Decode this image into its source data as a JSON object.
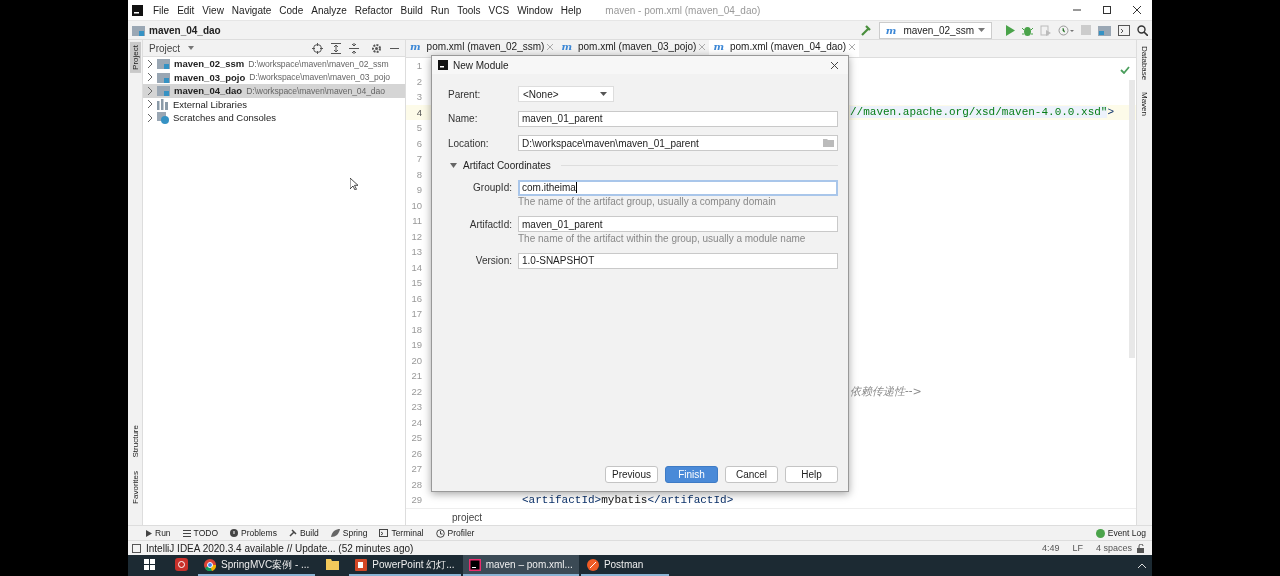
{
  "menu_bar": {
    "items": [
      "File",
      "Edit",
      "View",
      "Navigate",
      "Code",
      "Analyze",
      "Refactor",
      "Build",
      "Run",
      "Tools",
      "VCS",
      "Window",
      "Help"
    ],
    "title": "maven - pom.xml (maven_04_dao)"
  },
  "nav_bar": {
    "breadcrumb": "maven_04_dao",
    "run_config": "maven_02_ssm",
    "run_config_icon": "m"
  },
  "left_strip": [
    {
      "label": "Project",
      "selected": true
    },
    {
      "label": "Structure",
      "selected": false
    },
    {
      "label": "Favorites",
      "selected": false
    }
  ],
  "right_strip": [
    {
      "label": "Database"
    },
    {
      "label": "Maven"
    }
  ],
  "project_panel": {
    "title": "Project",
    "items": [
      {
        "kind": "module",
        "name": "maven_02_ssm",
        "path": "D:\\workspace\\maven\\maven_02_ssm",
        "selected": false
      },
      {
        "kind": "module",
        "name": "maven_03_pojo",
        "path": "D:\\workspace\\maven\\maven_03_pojo",
        "selected": false
      },
      {
        "kind": "module",
        "name": "maven_04_dao",
        "path": "D:\\workspace\\maven\\maven_04_dao",
        "selected": true
      },
      {
        "kind": "library",
        "name": "External Libraries",
        "selected": false
      },
      {
        "kind": "scratches",
        "name": "Scratches and Consoles",
        "selected": false
      }
    ]
  },
  "editor": {
    "tabs": [
      {
        "icon": "m",
        "label": "pom.xml (maven_02_ssm)",
        "selected": false
      },
      {
        "icon": "m",
        "label": "pom.xml (maven_03_pojo)",
        "selected": false
      },
      {
        "icon": "m",
        "label": "pom.xml (maven_04_dao)",
        "selected": true
      }
    ],
    "lines": [
      {
        "number": "1",
        "current": false
      },
      {
        "number": "2",
        "current": false
      },
      {
        "number": "3",
        "current": false
      },
      {
        "number": "4",
        "current": true,
        "kind": "after-dialog",
        "parts": [
          {
            "kind": "string",
            "text": "//maven.apache.org/xsd/maven-4.0.0.xsd\""
          },
          {
            "kind": "tag",
            "text": ">"
          }
        ]
      },
      {
        "number": "5",
        "current": false
      },
      {
        "number": "6",
        "current": false
      },
      {
        "number": "7",
        "current": false
      },
      {
        "number": "8",
        "current": false
      },
      {
        "number": "9",
        "current": false
      },
      {
        "number": "10",
        "current": false
      },
      {
        "number": "11",
        "current": false
      },
      {
        "number": "12",
        "current": false
      },
      {
        "number": "13",
        "current": false
      },
      {
        "number": "14",
        "current": false
      },
      {
        "number": "15",
        "current": false
      },
      {
        "number": "16",
        "current": false
      },
      {
        "number": "17",
        "current": false
      },
      {
        "number": "18",
        "current": false
      },
      {
        "number": "19",
        "current": false
      },
      {
        "number": "20",
        "current": false
      },
      {
        "number": "21",
        "current": false
      },
      {
        "number": "22",
        "current": false,
        "kind": "after-dialog",
        "parts": [
          {
            "kind": "comment",
            "text": "依赖传递性-->"
          }
        ]
      },
      {
        "number": "23",
        "current": false
      },
      {
        "number": "24",
        "current": false
      },
      {
        "number": "25",
        "current": false
      },
      {
        "number": "26",
        "current": false
      },
      {
        "number": "27",
        "current": false
      },
      {
        "number": "28",
        "current": false
      },
      {
        "number": "29",
        "current": false,
        "kind": "code",
        "parts": [
          {
            "kind": "tag",
            "text": "<artifactId>"
          },
          {
            "kind": "text",
            "text": "mybatis"
          },
          {
            "kind": "tag",
            "text": "</artifactId>"
          }
        ]
      }
    ],
    "breadcrumb": "project"
  },
  "dialog": {
    "title": "New Module",
    "fields": [
      {
        "kind": "dropdown",
        "label": "Parent:",
        "value": "<None>",
        "focused": false
      },
      {
        "kind": "text",
        "label": "Name:",
        "value": "maven_01_parent",
        "focused": false
      },
      {
        "kind": "path",
        "label": "Location:",
        "value": "D:\\workspace\\maven\\maven_01_parent",
        "focused": false
      }
    ],
    "section": {
      "title": "Artifact Coordinates",
      "expanded": true,
      "fields": [
        {
          "label": "GroupId:",
          "value": "com.itheima",
          "focused": true,
          "hint": "The name of the artifact group, usually a company domain"
        },
        {
          "label": "ArtifactId:",
          "value": "maven_01_parent",
          "focused": false,
          "hint": "The name of the artifact within the group, usually a module name"
        },
        {
          "label": "Version:",
          "value": "1.0-SNAPSHOT",
          "focused": false
        }
      ]
    },
    "buttons": [
      {
        "label": "Previous",
        "primary": false
      },
      {
        "label": "Finish",
        "primary": true
      },
      {
        "label": "Cancel",
        "primary": false
      },
      {
        "label": "Help",
        "primary": false
      }
    ]
  },
  "tool_windows": [
    {
      "kind": "run",
      "label": "Run"
    },
    {
      "kind": "todo",
      "label": "TODO"
    },
    {
      "kind": "problems",
      "label": "Problems"
    },
    {
      "kind": "build",
      "label": "Build"
    },
    {
      "kind": "spring",
      "label": "Spring"
    },
    {
      "kind": "terminal",
      "label": "Terminal"
    },
    {
      "kind": "profiler",
      "label": "Profiler"
    }
  ],
  "event_log": "Event Log",
  "status_bar": {
    "message": "IntelliJ IDEA 2020.3.4 available // Update... (52 minutes ago)",
    "items": [
      "4:49",
      "LF",
      "4 spaces"
    ]
  },
  "taskbar": [
    {
      "kind": "start",
      "running": false,
      "selected": false
    },
    {
      "kind": "red-app",
      "running": false,
      "selected": false
    },
    {
      "kind": "browser",
      "label": "SpringMVC案例 - ...",
      "running": true,
      "selected": false
    },
    {
      "kind": "files",
      "running": false,
      "selected": false
    },
    {
      "kind": "presentation",
      "label": "PowerPoint 幻灯...",
      "running": true,
      "selected": false
    },
    {
      "kind": "ide",
      "label": "maven – pom.xml...",
      "running": true,
      "selected": true
    },
    {
      "kind": "postman",
      "label": "Postman",
      "running": true,
      "selected": false
    }
  ]
}
